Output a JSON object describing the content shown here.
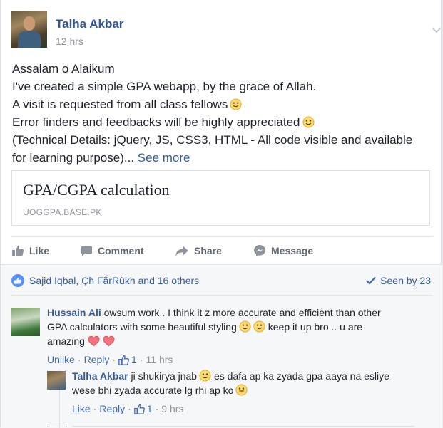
{
  "post": {
    "author": "Talha Akbar",
    "time": "12 hrs",
    "lines": [
      "Assalam o Alaikum",
      "I've created a simple GPA webapp, by the grace of Allah.",
      "A visit is requested from all class fellows",
      "Error finders and feedbacks will be highly appreciated",
      "(Technical Details: jQuery, JS, CSS3, HTML - All code visible and available",
      "for learning purpose)..."
    ],
    "see_more": "See more"
  },
  "link_card": {
    "title": "GPA/CGPA calculation",
    "domain": "UOGGPA.BASE.PK"
  },
  "actions": {
    "like": "Like",
    "comment": "Comment",
    "share": "Share",
    "message": "Message"
  },
  "feedback": {
    "likers": "Sajid Iqbal, Çħ FắrRùkh and 16 others",
    "seen_by": "Seen by 23"
  },
  "comments": [
    {
      "author": "Hussain Ali",
      "lines": [
        "owsum work . I think it z more accurate and efficient than other",
        "GPA calculators with some beautiful styling",
        "keep it up bro .. u are",
        "amazing"
      ],
      "action_primary": "Unlike",
      "action_reply": "Reply",
      "likes": "1",
      "time": "11 hrs"
    },
    {
      "author": "Talha Akbar",
      "lines": [
        "ji shukirya jnab",
        "es dafa ap ka zyada gpa aaya na esliye",
        "wese bhi zyada accurate lg rhi ap ko"
      ],
      "action_primary": "Like",
      "action_reply": "Reply",
      "likes": "1",
      "time": "9 hrs"
    }
  ],
  "icons": {
    "emoji": "smile-emoji-icon",
    "heart": "heart-emoji-icon",
    "like": "thumbs-up-icon",
    "comment": "comment-icon",
    "share": "share-icon",
    "message": "messenger-icon",
    "check": "check-icon",
    "chevron": "chevron-down-icon"
  },
  "colors": {
    "link": "#365899",
    "meta": "#90949c",
    "accent": "#4267b2"
  }
}
